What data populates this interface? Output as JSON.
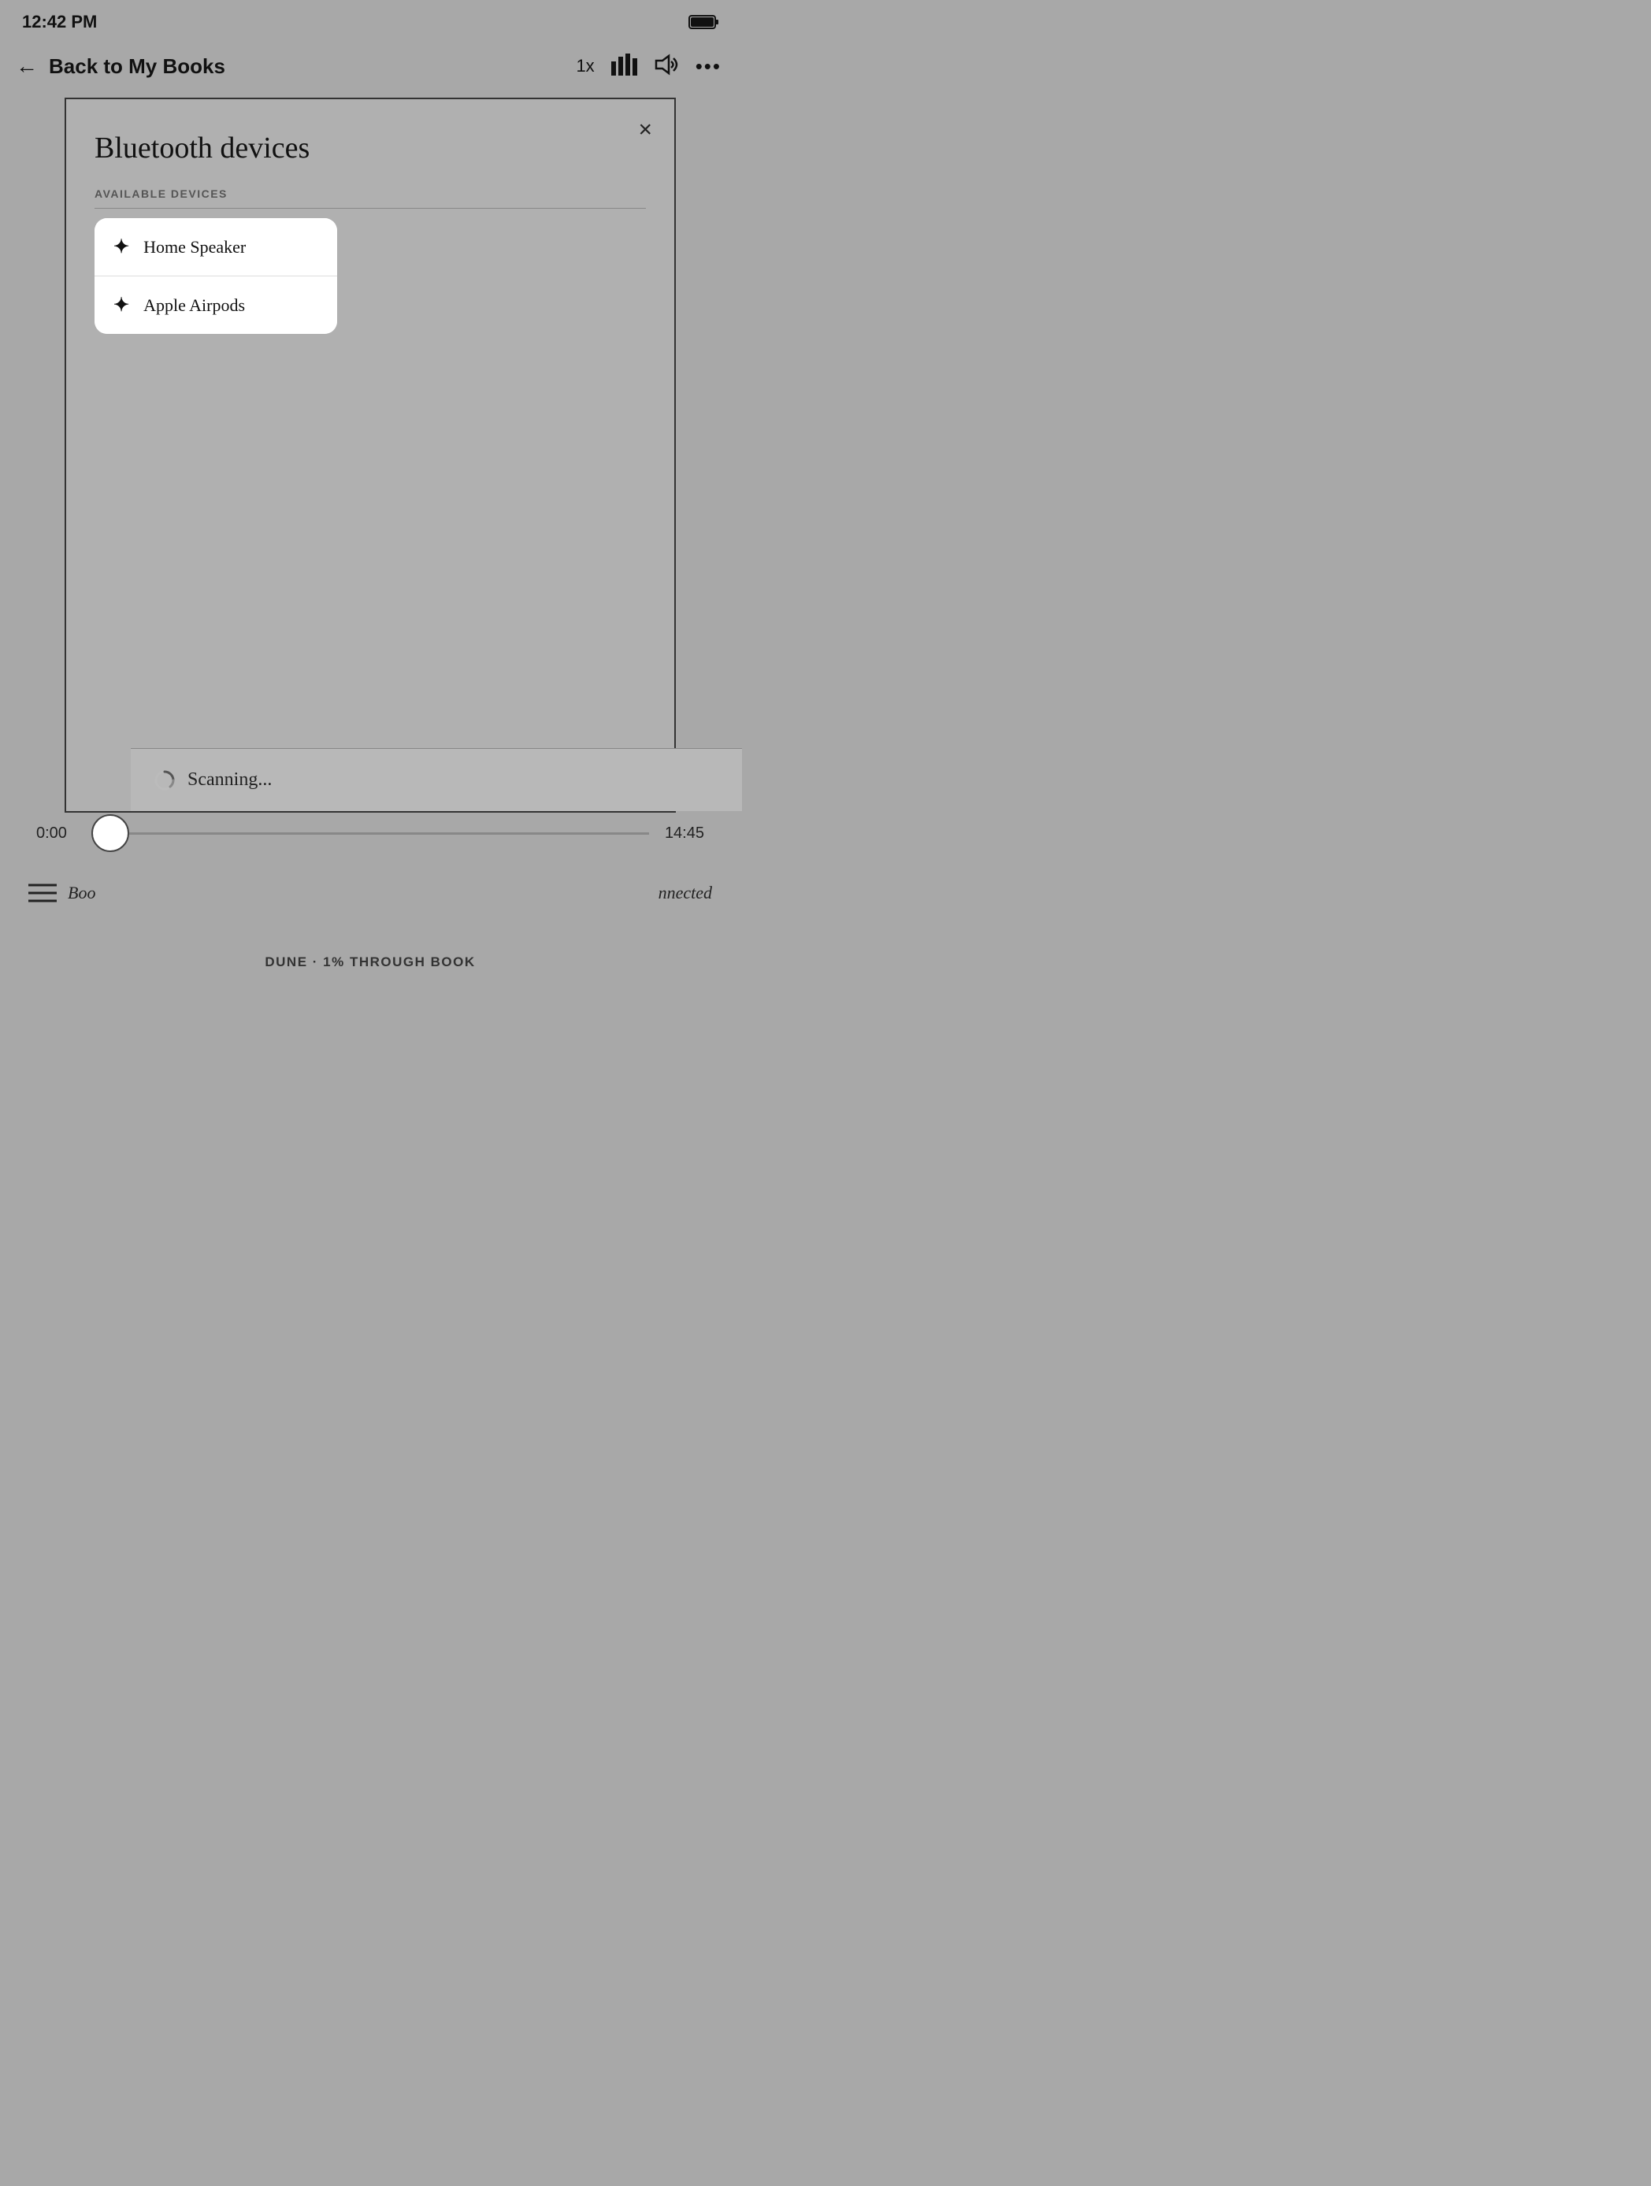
{
  "statusBar": {
    "time": "12:42 PM"
  },
  "navBar": {
    "backLabel": "Back to My Books",
    "speedLabel": "1x",
    "moreLabel": "•••"
  },
  "dialog": {
    "title": "Bluetooth devices",
    "closeLabel": "×",
    "sectionLabel": "AVAILABLE DEVICES",
    "devices": [
      {
        "name": "Home Speaker"
      },
      {
        "name": "Apple Airpods"
      }
    ]
  },
  "progress": {
    "timeStart": "0:00",
    "timeEnd": "14:45"
  },
  "scanning": {
    "text": "Scanning..."
  },
  "toolbar": {
    "bookmarksLabel": "Boo",
    "connectedLabel": "nnected"
  },
  "footer": {
    "text": "DUNE · 1% THROUGH BOOK"
  }
}
